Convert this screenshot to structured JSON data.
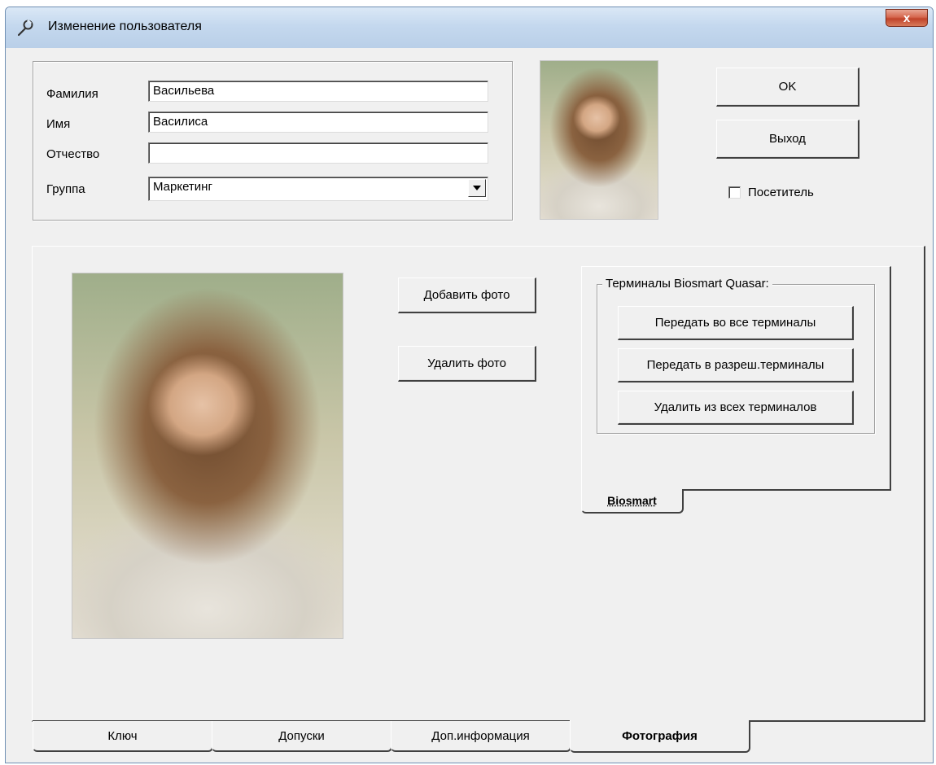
{
  "window": {
    "title": "Изменение пользователя",
    "title_icon": "wrench-icon",
    "close_label": "x"
  },
  "form": {
    "lastname": {
      "label": "Фамилия",
      "value": "Васильева"
    },
    "firstname": {
      "label": "Имя",
      "value": "Василиса"
    },
    "middlename": {
      "label": "Отчество",
      "value": ""
    },
    "group": {
      "label": "Группа",
      "value": "Маркетинг"
    }
  },
  "buttons": {
    "ok": "OK",
    "exit": "Выход",
    "visitor_label": "Посетитель",
    "visitor_checked": false,
    "add_photo": "Добавить фото",
    "delete_photo": "Удалить фото"
  },
  "biosmart": {
    "group_title": "Терминалы Biosmart Quasar:",
    "send_all": "Передать во все терминалы",
    "send_allowed": "Передать в разреш.терминалы",
    "delete_all": "Удалить из всех терминалов",
    "tab_label": "Biosmart"
  },
  "tabs": [
    {
      "label": "Ключ",
      "active": false
    },
    {
      "label": "Допуски",
      "active": false
    },
    {
      "label": "Доп.информация",
      "active": false
    },
    {
      "label": "Фотография",
      "active": true
    }
  ]
}
